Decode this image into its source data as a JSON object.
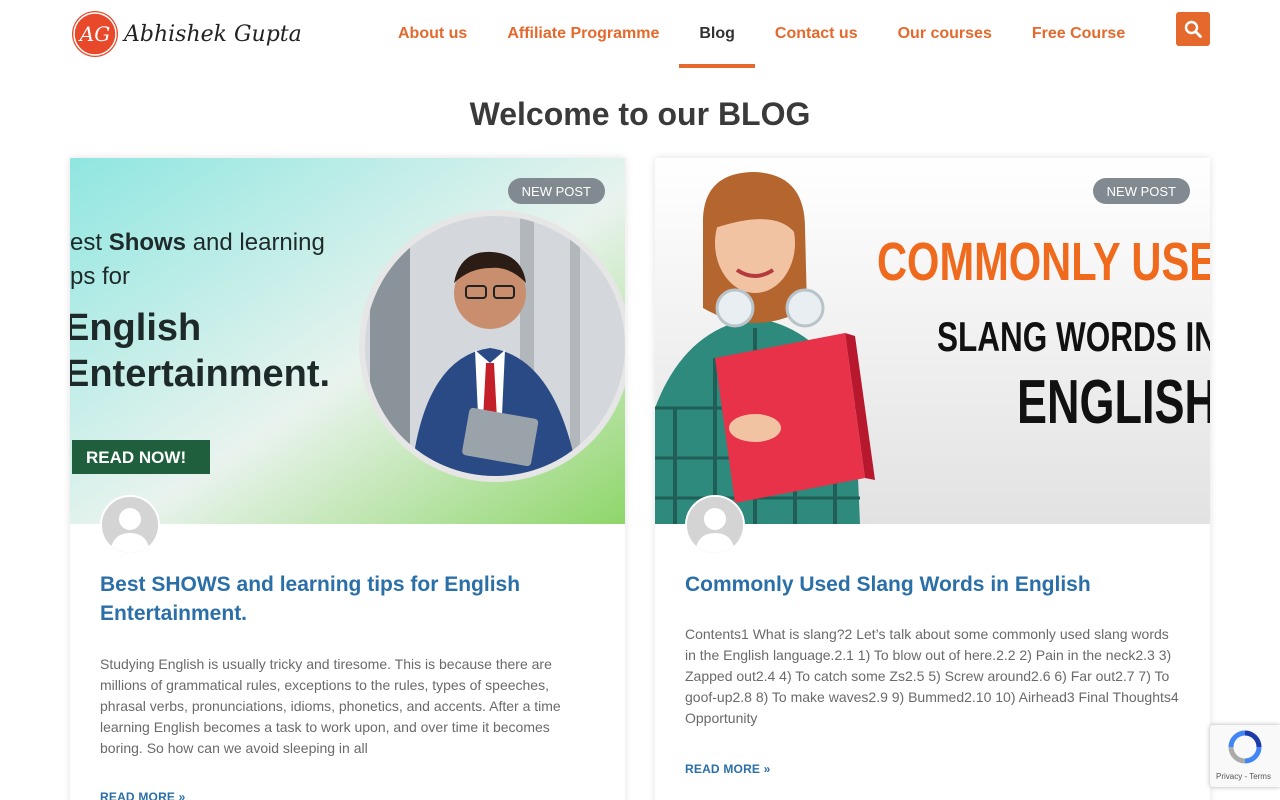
{
  "logo": {
    "text": "Abhishek Gupta",
    "mark": "AG"
  },
  "nav": {
    "items": [
      {
        "label": "About us"
      },
      {
        "label": "Affiliate Programme"
      },
      {
        "label": "Blog"
      },
      {
        "label": "Contact us"
      },
      {
        "label": "Our courses"
      },
      {
        "label": "Free Course"
      }
    ],
    "active": "Blog",
    "search_icon": "search-icon"
  },
  "page": {
    "title": "Welcome to our BLOG"
  },
  "posts": [
    {
      "badge": "NEW POST",
      "title": "Best SHOWS and learning tips for English Entertainment.",
      "excerpt": "Studying English is usually tricky and tiresome. This is because there are millions of grammatical rules, exceptions to the rules, types of speeches, phrasal verbs, pronunciations, idioms, phonetics, and accents. After a time learning English becomes a task to work upon, and over time it becomes boring. So how can we avoid sleeping in all",
      "read_more": "READ MORE »",
      "image": {
        "line1a": "est ",
        "line1b": "Shows",
        "line1c": " and learning",
        "line2": "ps for",
        "line3": "English",
        "line4": "Entertainment.",
        "cta": "READ NOW!"
      }
    },
    {
      "badge": "NEW POST",
      "title": "Commonly Used Slang Words in English",
      "excerpt": "Contents1 What is slang?2 Let’s talk about some commonly used slang words in the English language.2.1 1) To blow out of here.2.2 2) Pain in the neck2.3 3) Zapped out2.4 4) To catch some Zs2.5 5) Screw around2.6 6) Far out2.7 7) To goof-up2.8 8) To make waves2.9 9) Bummed2.10 10) Airhead3 Final Thoughts4 Opportunity",
      "read_more": "READ MORE »",
      "image": {
        "line1": "COMMONLY USE",
        "line2": "SLANG WORDS IN",
        "line3": "ENGLISH"
      }
    }
  ],
  "recaptcha": {
    "links": "Privacy - Terms"
  },
  "colors": {
    "accent": "#e5692c",
    "link": "#2a6fa8",
    "badge": "#818a91",
    "heading": "#3a3a3a"
  }
}
